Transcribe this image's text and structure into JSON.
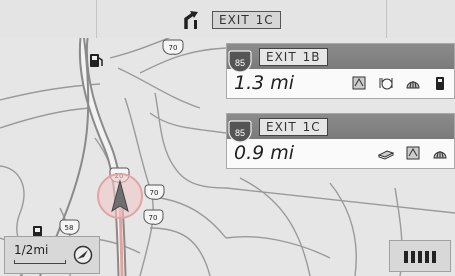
{
  "top_bar": {
    "next_exit_label": "EXIT",
    "next_exit_number": "1C",
    "icons": [
      "exit-arrow-icon"
    ]
  },
  "exits": [
    {
      "shield_number": "85",
      "exit_label": "EXIT",
      "exit_number": "1B",
      "distance": "1.3 mi",
      "services": [
        "lodging-icon",
        "restaurant-icon",
        "gas-station-icon",
        "fuel-pump-icon"
      ]
    },
    {
      "shield_number": "85",
      "exit_label": "EXIT",
      "exit_number": "1C",
      "distance": "0.9 mi",
      "services": [
        "hotel-icon",
        "lodging-icon",
        "gas-station-icon"
      ]
    }
  ],
  "map": {
    "road_shield_labels": [
      "70",
      "20",
      "70",
      "70",
      "58"
    ],
    "icons": [
      "vehicle-position-icon",
      "fuel-pump-icon"
    ]
  },
  "scale": {
    "label": "1/2mi"
  },
  "status": {
    "signal_bars": 5
  }
}
